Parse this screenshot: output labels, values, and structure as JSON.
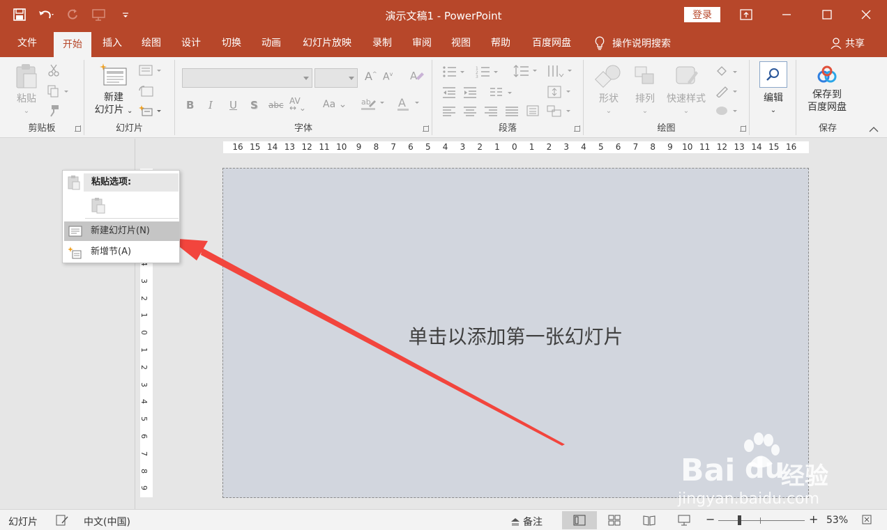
{
  "window": {
    "title": "演示文稿1  -  PowerPoint",
    "login_label": "登录"
  },
  "tabs": [
    {
      "label": "文件"
    },
    {
      "label": "开始"
    },
    {
      "label": "插入"
    },
    {
      "label": "绘图"
    },
    {
      "label": "设计"
    },
    {
      "label": "切换"
    },
    {
      "label": "动画"
    },
    {
      "label": "幻灯片放映"
    },
    {
      "label": "录制"
    },
    {
      "label": "审阅"
    },
    {
      "label": "视图"
    },
    {
      "label": "帮助"
    },
    {
      "label": "百度网盘"
    }
  ],
  "search_help": "操作说明搜索",
  "share": "共享",
  "ribbon": {
    "clipboard": {
      "label": "剪贴板",
      "paste": "粘贴"
    },
    "slides": {
      "label": "幻灯片",
      "new_slide_1": "新建",
      "new_slide_2": "幻灯片"
    },
    "font": {
      "label": "字体"
    },
    "paragraph": {
      "label": "段落"
    },
    "drawing": {
      "label": "绘图",
      "shapes": "形状",
      "arrange": "排列",
      "quick_styles": "快速样式"
    },
    "editing": {
      "label": "编辑"
    },
    "save": {
      "label": "保存",
      "save_to_1": "保存到",
      "save_to_2": "百度网盘"
    }
  },
  "ruler": {
    "h": [
      "16",
      "15",
      "14",
      "13",
      "12",
      "11",
      "10",
      "9",
      "8",
      "7",
      "6",
      "5",
      "4",
      "3",
      "2",
      "1",
      "0",
      "1",
      "2",
      "3",
      "4",
      "5",
      "6",
      "7",
      "8",
      "9",
      "10",
      "11",
      "12",
      "13",
      "14",
      "15",
      "16"
    ],
    "v": [
      "4",
      "3",
      "2",
      "1",
      "0",
      "1",
      "2",
      "3",
      "4",
      "5",
      "6",
      "7",
      "8",
      "9"
    ]
  },
  "slide": {
    "placeholder": "单击以添加第一张幻灯片"
  },
  "context_menu": {
    "header": "粘贴选项:",
    "new_slide": "新建幻灯片(N)",
    "new_section": "新增节(A)"
  },
  "status": {
    "slide": "幻灯片",
    "language": "中文(中国)",
    "notes": "备注",
    "zoom": "53%"
  },
  "watermark": {
    "brand": "Bai",
    "brand2": "du",
    "suffix": "经验",
    "url": "jingyan.baidu.com"
  },
  "colors": {
    "accent": "#b7472a",
    "ribbon": "#f3f3f3",
    "slide": "#d2d6de",
    "arrow": "#f2453d"
  }
}
